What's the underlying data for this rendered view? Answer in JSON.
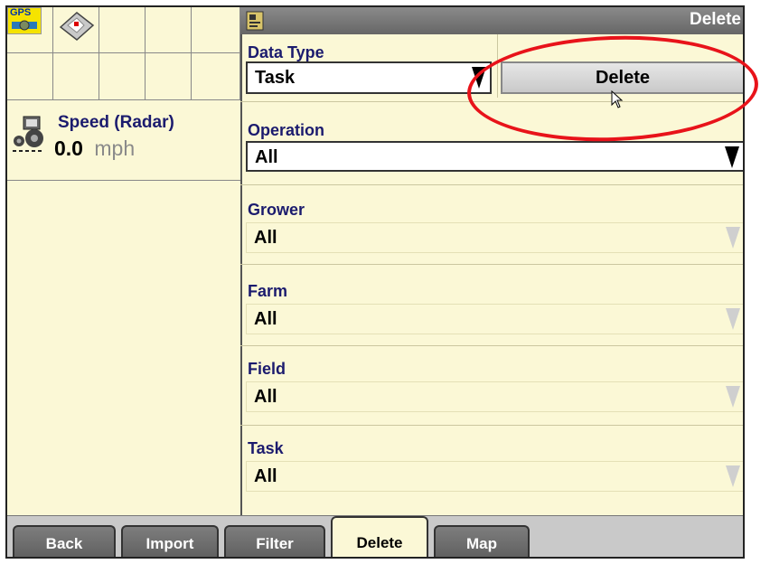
{
  "status_tiles": {
    "gps_label": "GPS"
  },
  "speed": {
    "label": "Speed (Radar)",
    "value": "0.0",
    "unit": "mph"
  },
  "panel": {
    "title": "Delete"
  },
  "data_type": {
    "label": "Data Type",
    "value": "Task",
    "delete_button_label": "Delete"
  },
  "fields": [
    {
      "label": "Operation",
      "value": "All",
      "enabled": true
    },
    {
      "label": "Grower",
      "value": "All",
      "enabled": false
    },
    {
      "label": "Farm",
      "value": "All",
      "enabled": false
    },
    {
      "label": "Field",
      "value": "All",
      "enabled": false
    },
    {
      "label": "Task",
      "value": "All",
      "enabled": false
    }
  ],
  "tabs": [
    {
      "label": "Back",
      "active": false
    },
    {
      "label": "Import",
      "active": false
    },
    {
      "label": "Filter",
      "active": false
    },
    {
      "label": "Delete",
      "active": true
    },
    {
      "label": "Map",
      "active": false
    }
  ],
  "colors": {
    "panel_background": "#fbf8d6",
    "label_text": "#1b1b6e",
    "annotation": "#e8131a"
  },
  "icons": [
    "gps-receiver-icon",
    "memory-card-icon",
    "tractor-icon",
    "cursor-pointer-icon",
    "task-manager-icon"
  ]
}
